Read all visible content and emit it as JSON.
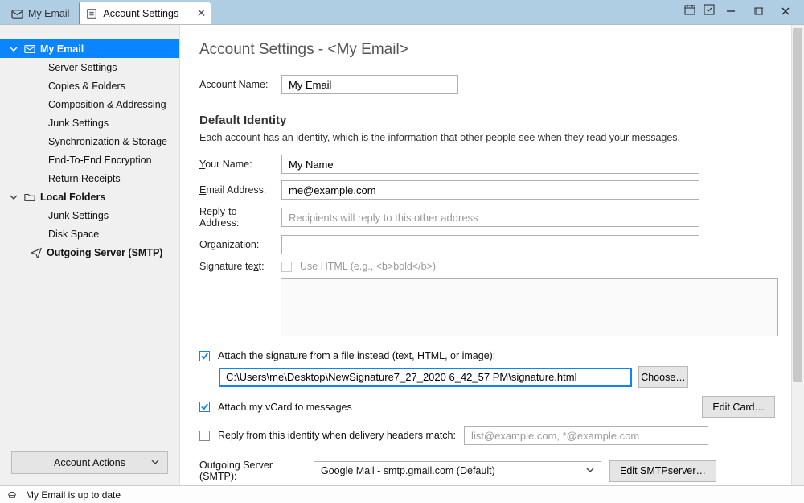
{
  "tabs": {
    "inactive": "My Email",
    "active": "Account Settings"
  },
  "sidebar": {
    "root": "My Email",
    "items": [
      "Server Settings",
      "Copies & Folders",
      "Composition & Addressing",
      "Junk Settings",
      "Synchronization & Storage",
      "End-To-End Encryption",
      "Return Receipts"
    ],
    "local": "Local Folders",
    "localItems": [
      "Junk Settings",
      "Disk Space"
    ],
    "outgoing": "Outgoing Server (SMTP)",
    "actions": "Account Actions"
  },
  "page": {
    "title": "Account Settings - <My Email>",
    "accountNameLabel": "Account Name:",
    "accountNameLabelPre": "Account ",
    "accountNameLabelU": "N",
    "accountNameLabelPost": "ame:",
    "accountNameValue": "My Email",
    "identityTitle": "Default Identity",
    "identityDesc": "Each account has an identity, which is the information that other people see when they read your messages.",
    "fields": {
      "yourName": {
        "labelPre": "",
        "labelU": "Y",
        "labelPost": "our Name:",
        "value": "My Name"
      },
      "email": {
        "labelPre": "",
        "labelU": "E",
        "labelPost": "mail Address:",
        "value": "me@example.com"
      },
      "reply": {
        "label": "Reply-to Address:",
        "placeholder": "Recipients will reply to this other address",
        "value": ""
      },
      "org": {
        "labelPre": "Organi",
        "labelU": "z",
        "labelPost": "ation:",
        "value": ""
      }
    },
    "sig": {
      "labelPre": "Signature te",
      "labelU": "x",
      "labelPost": "t:",
      "useHtml": "Use HTML (e.g., <b>bold</b>)"
    },
    "attachFile": {
      "label": "Attach the signature from a file instead (text, HTML, or image):",
      "value": "C:\\Users\\me\\Desktop\\NewSignature7_27_2020 6_42_57 PM\\signature.html",
      "choose": "Choose…"
    },
    "vcard": {
      "labelPre": "Attach my ",
      "labelU": "v",
      "labelPost": "Card to messages",
      "edit": "Edit Card…"
    },
    "replyHdr": {
      "labelPre": "Reply from this i",
      "labelU": "d",
      "labelPost": "entity when delivery headers match:",
      "placeholder": "list@example.com, *@example.com"
    },
    "outgoing": {
      "label": "Outgoing Server (SMTP):",
      "labelPre": "Out",
      "labelU": "g",
      "labelPost": "oing Server (SMTP):",
      "value": "Google Mail - smtp.gmail.com (Default)",
      "edit": "Edit SMTP server…",
      "editPre": "Edit SMT",
      "editU": "P",
      "editPost": " server…"
    }
  },
  "status": "My Email is up to date"
}
